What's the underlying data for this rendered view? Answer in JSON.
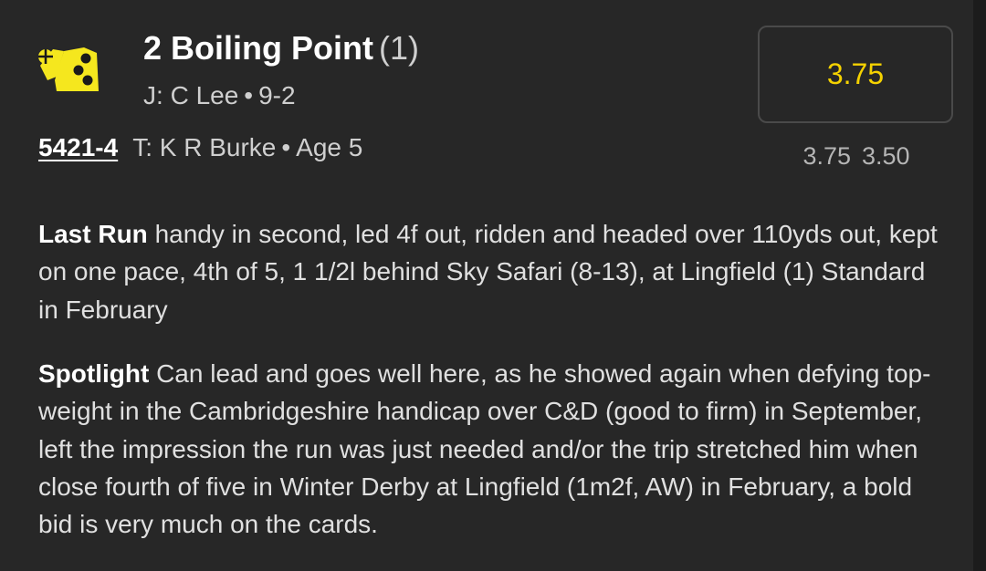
{
  "runner": {
    "number": "2",
    "name": "Boiling Point",
    "draw": "(1)",
    "jockey_label": "J:",
    "jockey": "C Lee",
    "weight": "9-2",
    "form": "5421-4",
    "trainer_label": "T:",
    "trainer": "K R Burke",
    "age": "Age 5",
    "separator": "•"
  },
  "silks": {
    "icon": "silks-icon",
    "colors": {
      "primary": "#f5e71e",
      "secondary": "#1a1a1a"
    }
  },
  "odds": {
    "current": "3.75",
    "history": [
      "3.75",
      "3.50"
    ],
    "accent_color": "#f5d200"
  },
  "last_run": {
    "label": "Last Run",
    "text": "handy in second, led 4f out, ridden and headed over 110yds out, kept on one pace, 4th of 5, 1 1/2l behind Sky Safari (8-13), at Lingfield (1) Standard in February"
  },
  "spotlight": {
    "label": "Spotlight",
    "text": "Can lead and goes well here, as he showed again when defying top-weight in the Cambridgeshire handicap over C&D (good to firm) in September, left the impression the run was just needed and/or the trip stretched him when close fourth of five in Winter Derby at Lingfield (1m2f, AW) in February, a bold bid is very much on the cards."
  }
}
